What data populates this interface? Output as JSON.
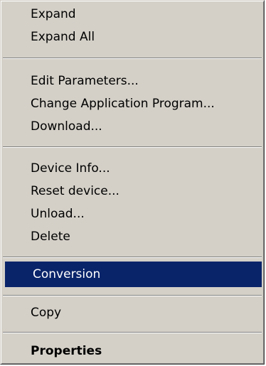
{
  "context_menu": {
    "items": [
      {
        "label": "Expand"
      },
      {
        "label": "Expand All"
      },
      {
        "label": "Edit Parameters..."
      },
      {
        "label": "Change Application Program..."
      },
      {
        "label": "Download..."
      },
      {
        "label": "Device Info..."
      },
      {
        "label": "Reset device..."
      },
      {
        "label": "Unload..."
      },
      {
        "label": "Delete"
      },
      {
        "label": "Conversion",
        "selected": true
      },
      {
        "label": "Copy"
      },
      {
        "label": "Properties",
        "default": true
      }
    ],
    "colors": {
      "menu_background": "#d4d0c8",
      "highlight_background": "#0a246a",
      "highlight_text": "#ffffff",
      "text": "#000000"
    }
  }
}
